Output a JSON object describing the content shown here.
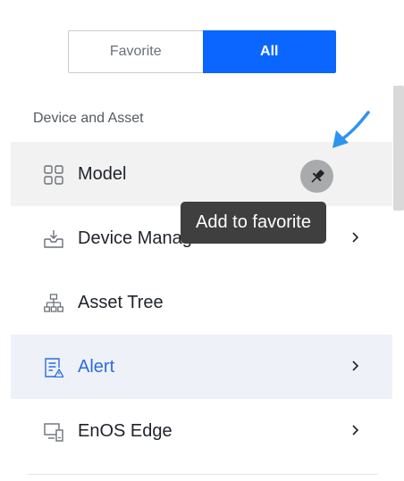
{
  "toggle": {
    "favorite_label": "Favorite",
    "all_label": "All",
    "selected": "All"
  },
  "section": {
    "title": "Device and Asset"
  },
  "menu": {
    "items": [
      {
        "label": "Model",
        "icon": "grid-icon",
        "state": "hover"
      },
      {
        "label": "Device Management",
        "icon": "inbox-download-icon",
        "has_submenu": true
      },
      {
        "label": "Asset Tree",
        "icon": "hierarchy-icon"
      },
      {
        "label": "Alert",
        "icon": "alert-document-icon",
        "state": "active",
        "has_submenu": true
      },
      {
        "label": "EnOS Edge",
        "icon": "edge-device-icon",
        "has_submenu": true
      }
    ]
  },
  "pin": {
    "icon": "pin-icon"
  },
  "tooltip": {
    "text": "Add to favorite"
  },
  "colors": {
    "primary": "#0a66ff",
    "active_text": "#2a6de0",
    "arrow": "#2e93ee",
    "tooltip_bg": "#3f3f3f"
  }
}
